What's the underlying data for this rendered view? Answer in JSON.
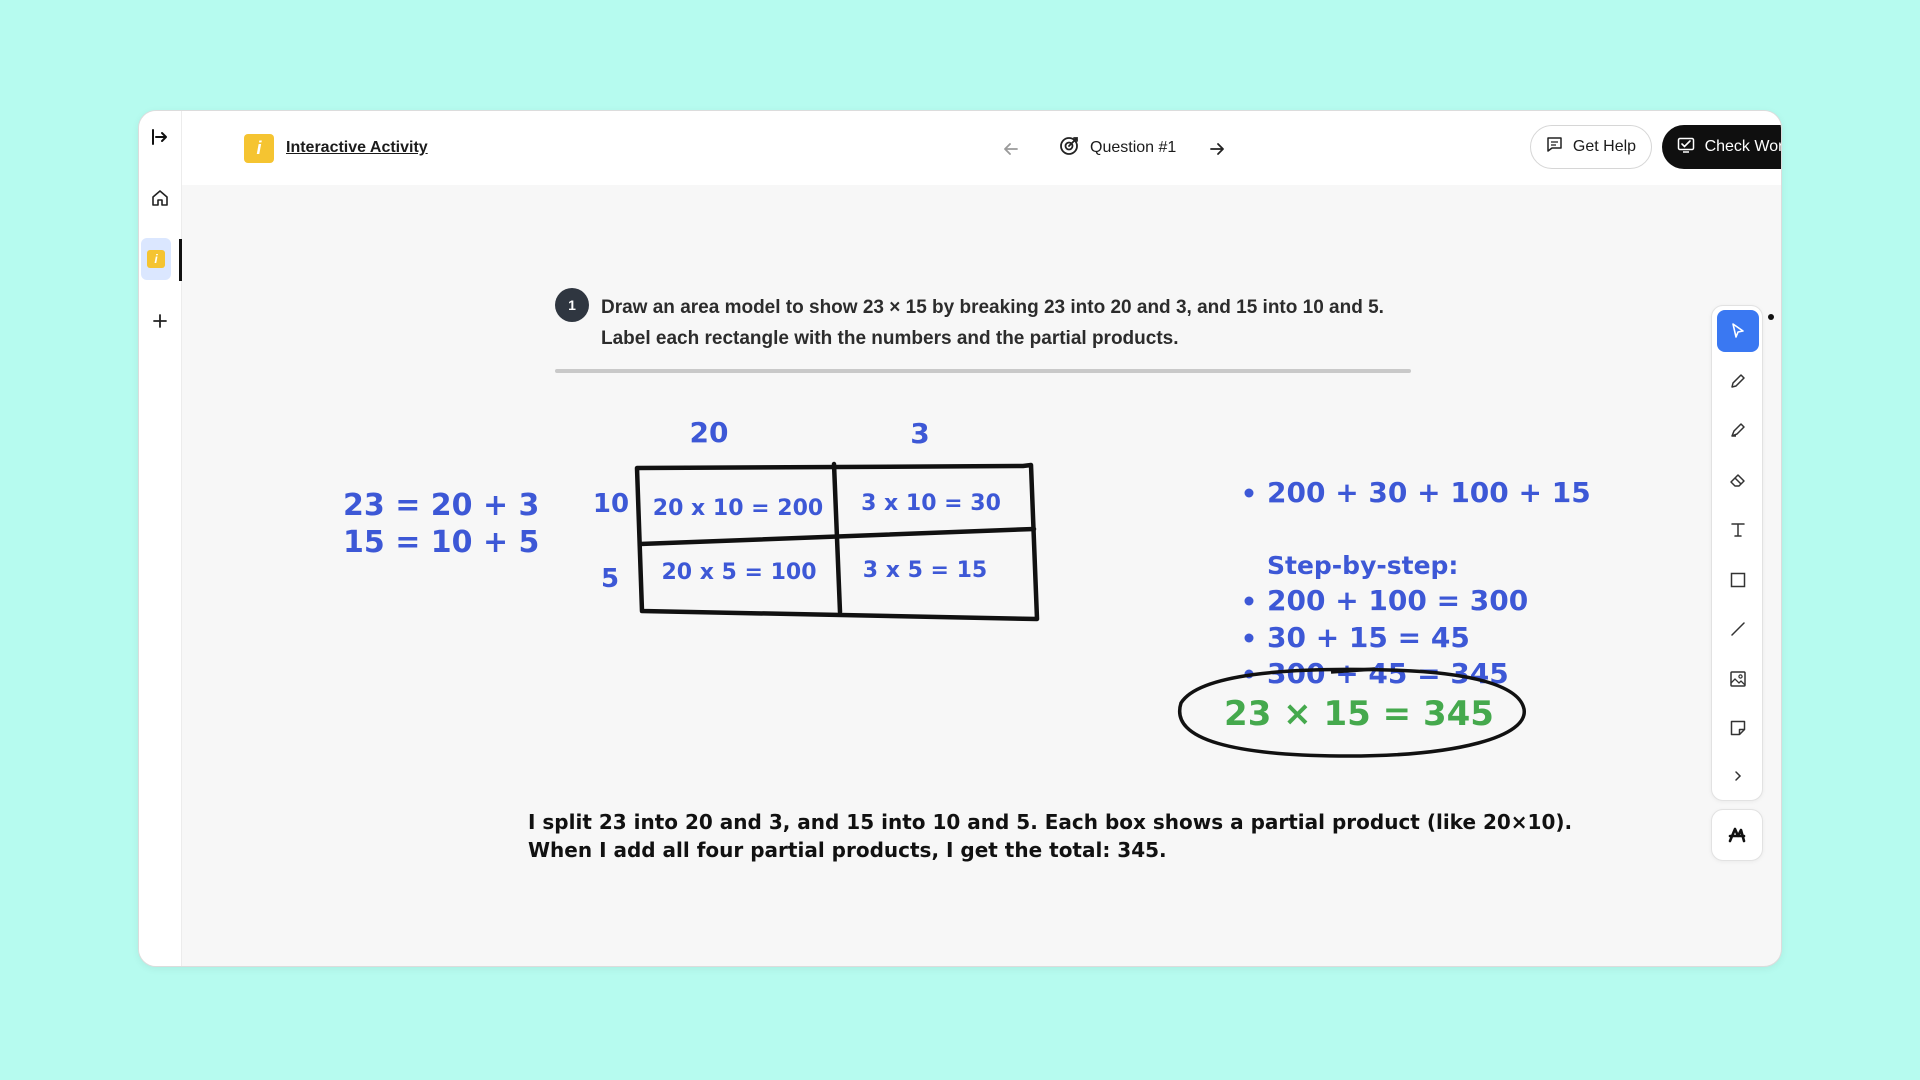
{
  "colors": {
    "background": "#b6fbef",
    "accent": "#3a78f2",
    "ink_blue": "#3d58d6",
    "ink_green": "#45a94d",
    "ink_black": "#111111",
    "logo": "#f5c431"
  },
  "rail": {
    "items": [
      {
        "icon": "collapse-sidebar-icon"
      },
      {
        "icon": "home-icon"
      },
      {
        "icon": "activity-icon",
        "active": true
      },
      {
        "icon": "plus-icon"
      }
    ]
  },
  "header": {
    "logo_letter": "i",
    "title": "Interactive Activity",
    "question_label": "Question #1",
    "prev_icon": "arrow-left-icon",
    "next_icon": "arrow-right-icon",
    "get_help_label": "Get Help",
    "check_work_label": "Check Work"
  },
  "question": {
    "number": "1",
    "line1": "Draw an area model to show 23 × 15 by breaking 23 into 20 and 3, and 15 into 10 and 5.",
    "line2": "Label each rectangle with the numbers and the partial products."
  },
  "drawing": {
    "decomp_line1": "23 = 20 + 3",
    "decomp_line2": "15 = 10 + 5",
    "col_headers": [
      "20",
      "3"
    ],
    "row_headers": [
      "10",
      "5"
    ],
    "cells": [
      [
        "20 x 10 = 200",
        "3 x 10 = 30"
      ],
      [
        "20 x 5 = 100",
        "3 x 5 = 15"
      ]
    ],
    "sum_line": "200 + 30 + 100 + 15",
    "steps_title": "Step-by-step:",
    "steps": [
      "200 + 100 = 300",
      "30 + 15 = 45",
      "300 + 45 = 345"
    ],
    "answer": "23 × 15 = 345",
    "explanation_line1": "I split 23 into 20 and 3, and 15 into 10 and 5. Each box shows a partial product (like 20×10).",
    "explanation_line2": "When I add all four partial products, I get the total: 345."
  },
  "toolbar": {
    "tools": [
      {
        "icon": "select-pointer-icon",
        "active": true
      },
      {
        "icon": "pencil-icon"
      },
      {
        "icon": "highlighter-icon"
      },
      {
        "icon": "eraser-icon"
      },
      {
        "icon": "text-tool-icon"
      },
      {
        "icon": "rectangle-tool-icon"
      },
      {
        "icon": "line-tool-icon"
      },
      {
        "icon": "image-tool-icon"
      },
      {
        "icon": "sticky-note-icon"
      },
      {
        "icon": "expand-chevron-icon"
      }
    ],
    "ai_icon": "ai-assist-icon"
  }
}
